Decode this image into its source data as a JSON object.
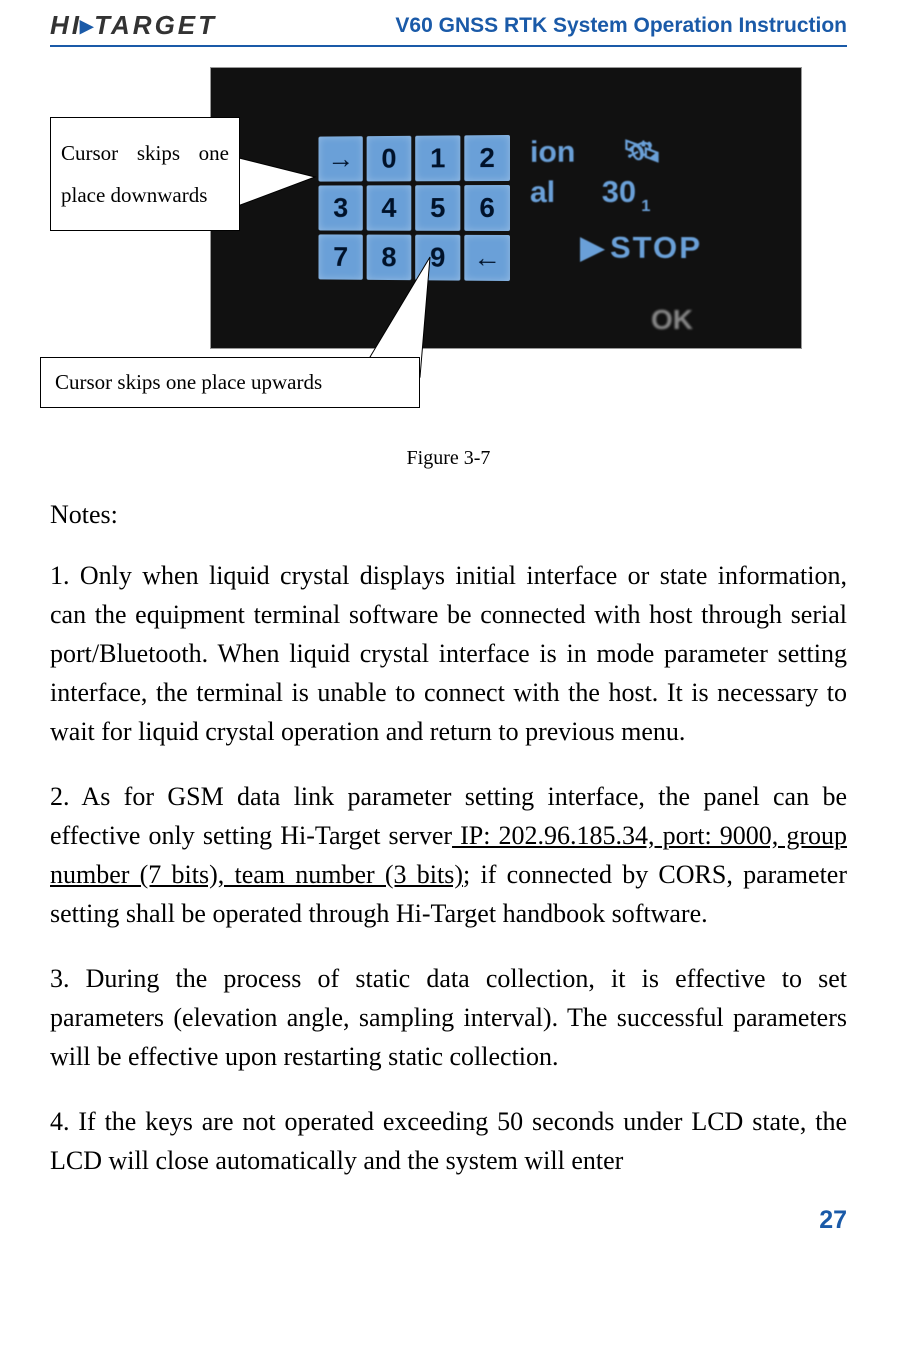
{
  "header": {
    "logo_left": "HI",
    "logo_right": "TARGET",
    "title": "V60 GNSS RTK System Operation Instruction"
  },
  "figure": {
    "callout1_line1": "Cursor skips one",
    "callout1_line2": "place downwards",
    "callout2": "Cursor skips one place upwards",
    "caption": "Figure 3-7",
    "keypad": [
      "→",
      "0",
      "1",
      "2",
      "3",
      "4",
      "5",
      "6",
      "7",
      "8",
      "9",
      "←"
    ],
    "status_ion": "ion",
    "status_al": "al",
    "status_30": "30",
    "status_1": "1",
    "status_stop": "STOP",
    "ok": "OK",
    "arrow_glyph": "▶",
    "sat_glyph": "🛰"
  },
  "body": {
    "notes_heading": "Notes:",
    "note1": "1. Only when liquid crystal displays initial interface or state information, can the equipment terminal software be connected with host through serial port/Bluetooth. When liquid crystal interface is in mode parameter setting interface, the terminal is unable to connect with the host. It is necessary to wait for liquid crystal operation and return to previous menu.",
    "note2_a": "2. As for GSM data link parameter setting interface, the panel can be effective only setting Hi-Target server",
    "note2_u": " IP: 202.96.185.34, port: 9000, group number (7 bits), team number (3 bits)",
    "note2_b": "; if connected by CORS, parameter setting shall be operated through Hi-Target handbook software.",
    "note3": "3. During the process of static data collection, it is effective to set parameters (elevation angle, sampling interval). The successful parameters will be effective upon restarting static collection.",
    "note4": "4. If the keys are not operated exceeding 50 seconds under LCD state, the LCD will close automatically and the system will enter"
  },
  "page_number": "27"
}
